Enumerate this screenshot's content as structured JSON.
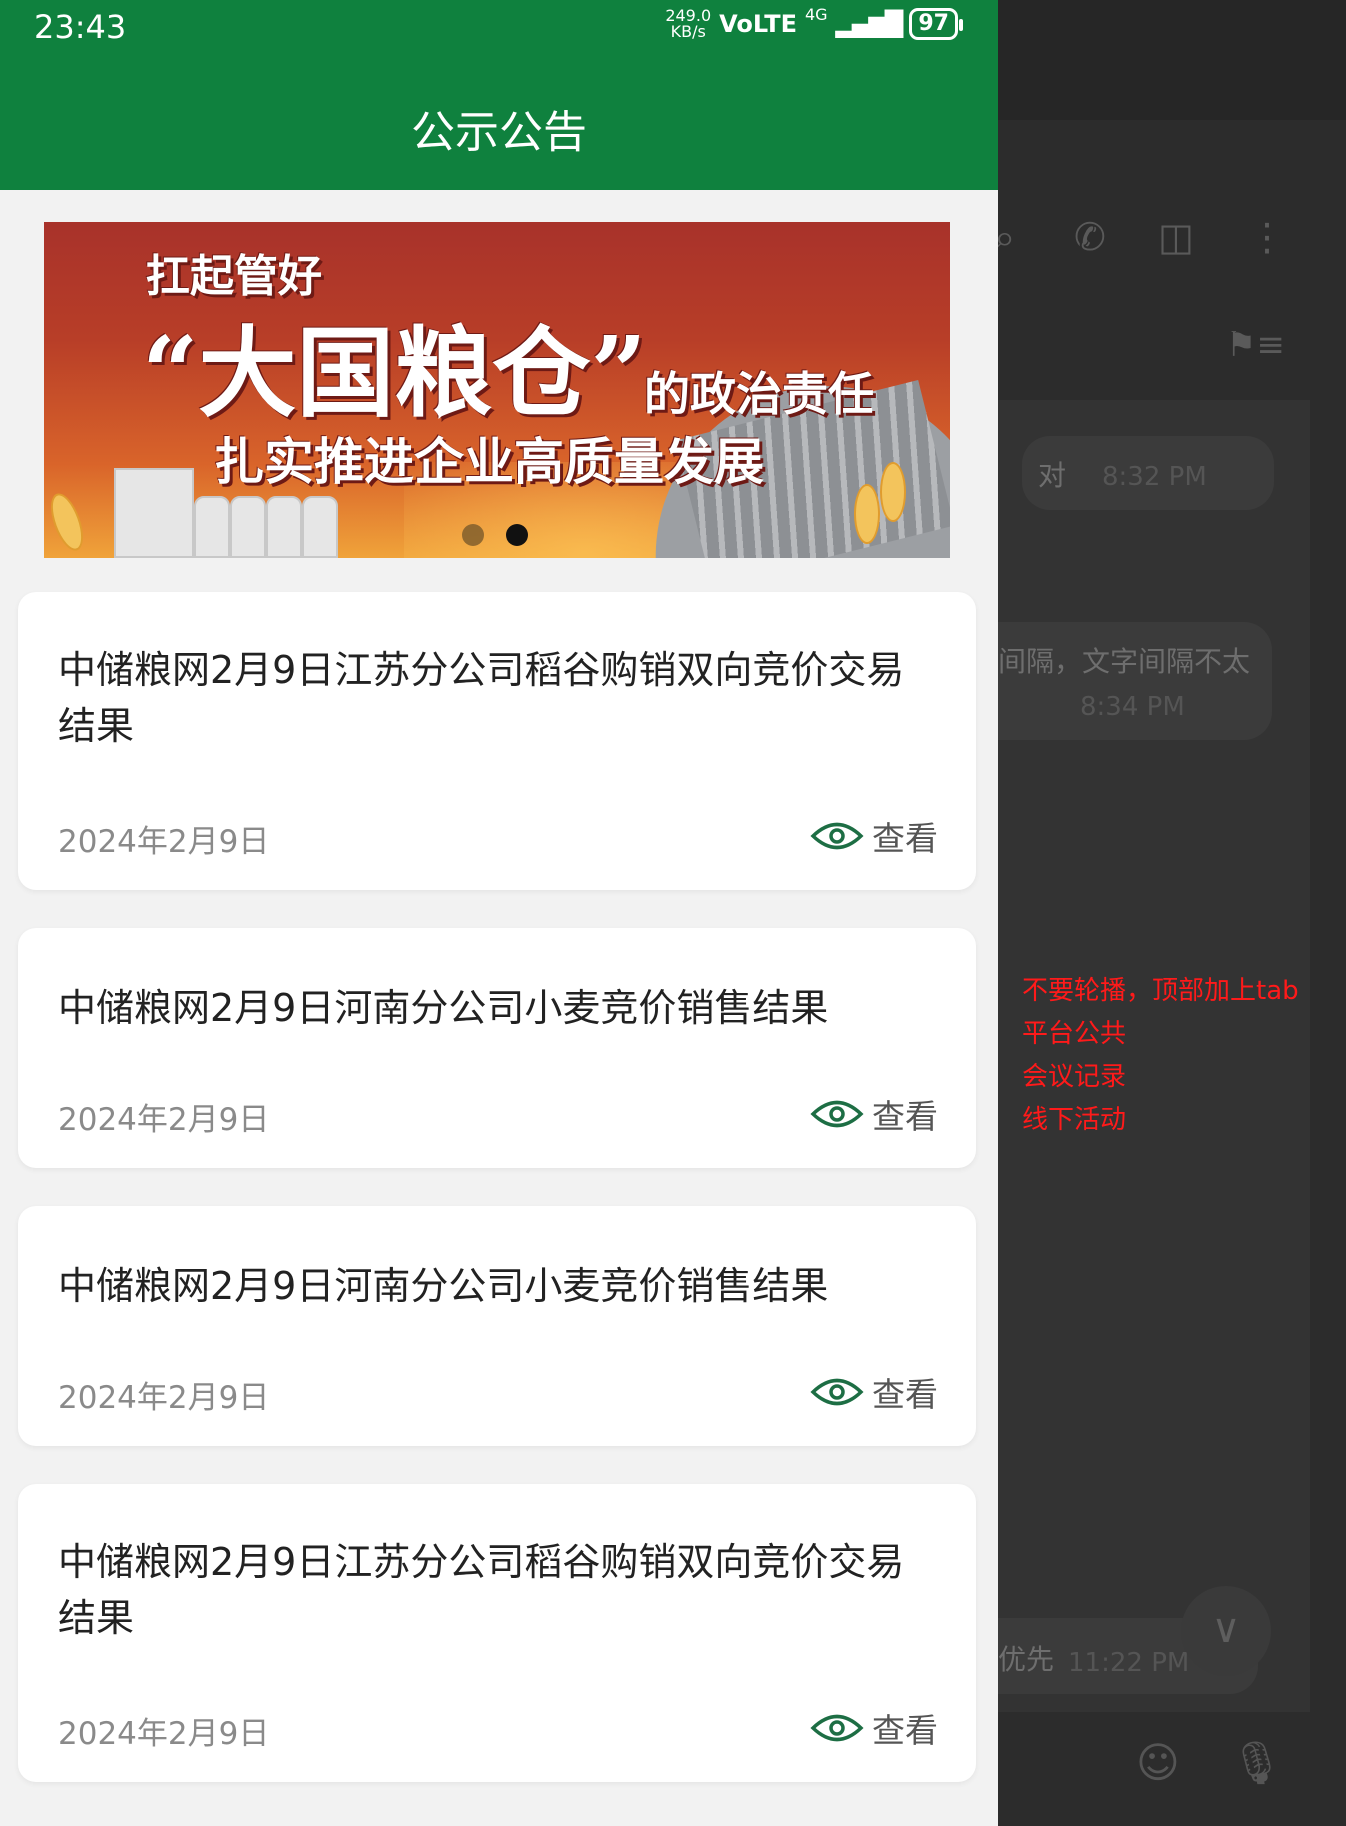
{
  "status_bar": {
    "time": "23:43",
    "net_speed_value": "249.0",
    "net_speed_unit": "KB/s",
    "volte": "VoLTE",
    "network": "4G",
    "battery": "97"
  },
  "header": {
    "title": "公示公告",
    "background_color": "#0f813e"
  },
  "banner": {
    "line1": "扛起管好",
    "line2": "“大国粮仓”",
    "line3": "的政治责任",
    "line4": "扎实推进企业高质量发展",
    "slide_count": 2,
    "active_slide": 2
  },
  "notices": [
    {
      "title": "中储粮网2月9日江苏分公司稻谷购销双向竞价交易结果",
      "date": "2024年2月9日",
      "view_label": "查看"
    },
    {
      "title": "中储粮网2月9日河南分公司小麦竞价销售结果",
      "date": "2024年2月9日",
      "view_label": "查看"
    },
    {
      "title": "中储粮网2月9日河南分公司小麦竞价销售结果",
      "date": "2024年2月9日",
      "view_label": "查看"
    },
    {
      "title": "中储粮网2月9日江苏分公司稻谷购销双向竞价交易结果",
      "date": "2024年2月9日",
      "view_label": "查看"
    }
  ],
  "chat": {
    "msg1_text": "对",
    "msg1_time": "8:32 PM",
    "msg2_text": "间隔，文字间隔不太",
    "msg2_time": "8:34 PM",
    "msg3_text": "优先",
    "msg3_time": "11:22 PM"
  },
  "annotation": {
    "lines": [
      "不要轮播，顶部加上tab",
      "平台公共",
      "会议记录",
      "线下活动"
    ],
    "color": "#ff1a1a"
  }
}
